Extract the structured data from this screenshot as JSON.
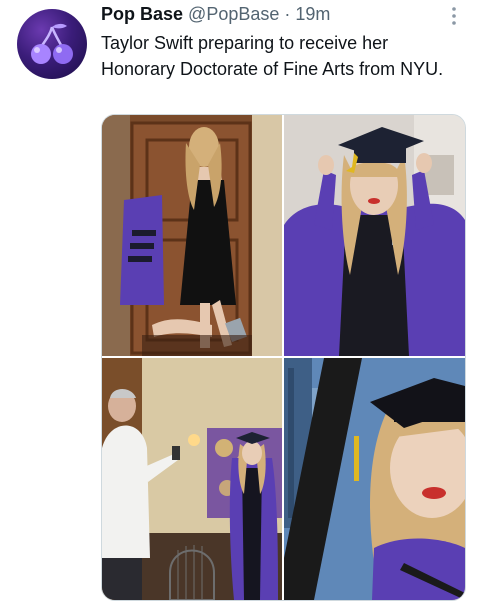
{
  "tweet": {
    "author": {
      "display_name": "Pop Base",
      "handle": "@PopBase",
      "avatar_icon": "cherries-icon"
    },
    "separator": "·",
    "timestamp": "19m",
    "text": "Taylor Swift preparing to receive her Honorary Doctorate of Fine Arts from NYU.",
    "more_icon": "more-vertical-icon",
    "media": {
      "photos": [
        {
          "subject": "photo-1"
        },
        {
          "subject": "photo-2"
        },
        {
          "subject": "photo-3"
        },
        {
          "subject": "photo-4"
        }
      ]
    }
  },
  "colors": {
    "text": "#0f1419",
    "secondary": "#536471",
    "gown_purple": "#5a3fb3",
    "avatar_bg": "#3b1d7a"
  }
}
